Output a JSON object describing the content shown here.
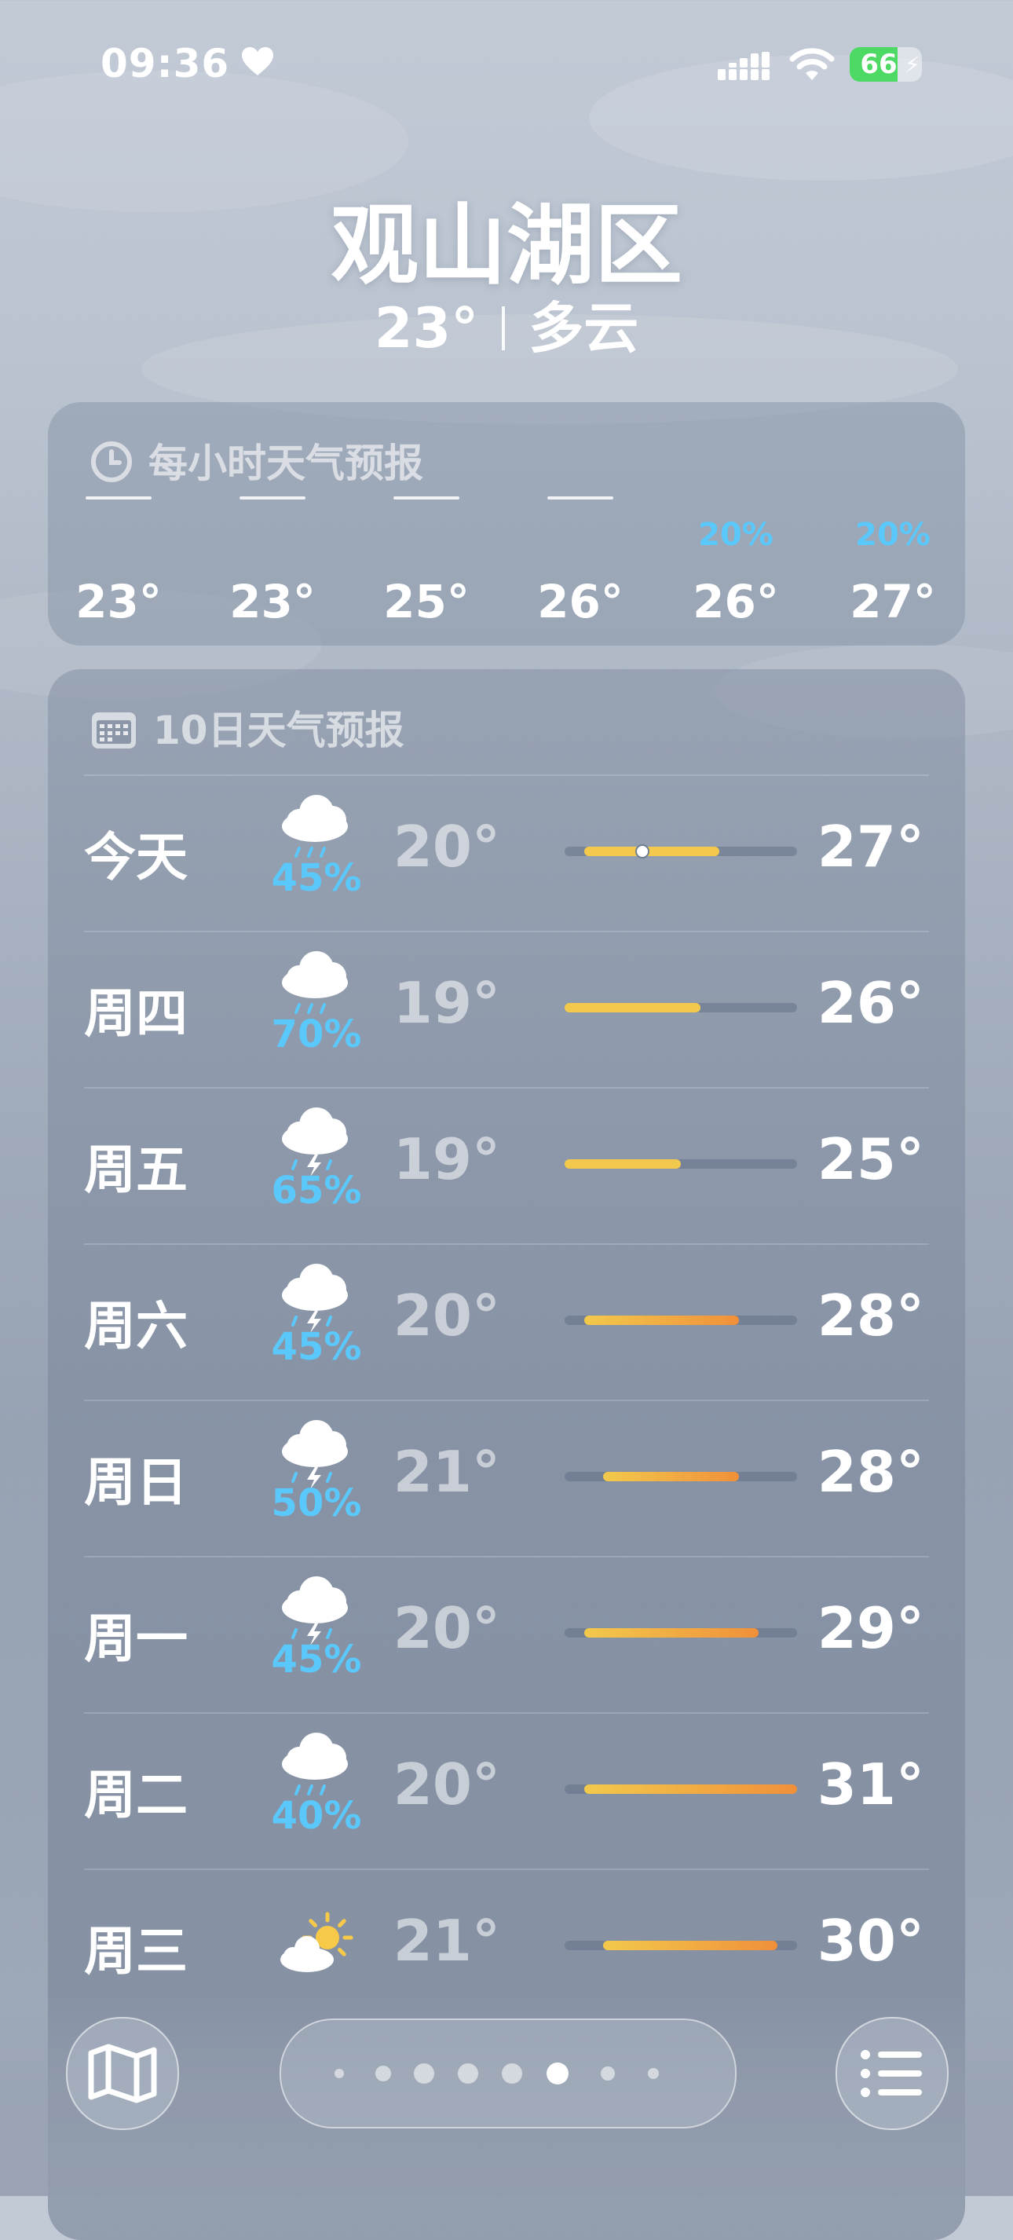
{
  "status": {
    "time": "09:36",
    "battery": "66",
    "battery_level": 0.66
  },
  "location": {
    "name": "观山湖区",
    "temp": "23°",
    "condition": "多云"
  },
  "hourly": {
    "title": "每小时天气预报",
    "icon": "clock-icon",
    "items": [
      {
        "pop": "",
        "temp": "23°"
      },
      {
        "pop": "",
        "temp": "23°"
      },
      {
        "pop": "",
        "temp": "25°"
      },
      {
        "pop": "",
        "temp": "26°"
      },
      {
        "pop": "20%",
        "temp": "26°"
      },
      {
        "pop": "20%",
        "temp": "27°"
      }
    ]
  },
  "ten_day": {
    "title": "10日天气预报",
    "icon": "calendar-icon",
    "range": {
      "min": 19,
      "max": 31
    },
    "current_temp": 23,
    "days": [
      {
        "day": "今天",
        "icon": "cloud-rain-icon",
        "pop": "45%",
        "low": "20°",
        "high": "27°",
        "low_val": 20,
        "high_val": 27
      },
      {
        "day": "周四",
        "icon": "cloud-rain-icon",
        "pop": "70%",
        "low": "19°",
        "high": "26°",
        "low_val": 19,
        "high_val": 26
      },
      {
        "day": "周五",
        "icon": "cloud-bolt-rain-icon",
        "pop": "65%",
        "low": "19°",
        "high": "25°",
        "low_val": 19,
        "high_val": 25
      },
      {
        "day": "周六",
        "icon": "cloud-bolt-rain-icon",
        "pop": "45%",
        "low": "20°",
        "high": "28°",
        "low_val": 20,
        "high_val": 28
      },
      {
        "day": "周日",
        "icon": "cloud-bolt-rain-icon",
        "pop": "50%",
        "low": "21°",
        "high": "28°",
        "low_val": 21,
        "high_val": 28
      },
      {
        "day": "周一",
        "icon": "cloud-bolt-rain-icon",
        "pop": "45%",
        "low": "20°",
        "high": "29°",
        "low_val": 20,
        "high_val": 29
      },
      {
        "day": "周二",
        "icon": "cloud-rain-icon",
        "pop": "40%",
        "low": "20°",
        "high": "31°",
        "low_val": 20,
        "high_val": 31
      },
      {
        "day": "周三",
        "icon": "partly-sunny-icon",
        "pop": "",
        "low": "21°",
        "high": "30°",
        "low_val": 21,
        "high_val": 30
      }
    ]
  },
  "colors": {
    "pop": "#5ac8fa",
    "bar_cool": "#f2c94c",
    "bar_warm": "#f0903a"
  },
  "nav": {
    "map_icon": "map-icon",
    "list_icon": "list-icon",
    "page_count": 8,
    "current_page": 5
  }
}
